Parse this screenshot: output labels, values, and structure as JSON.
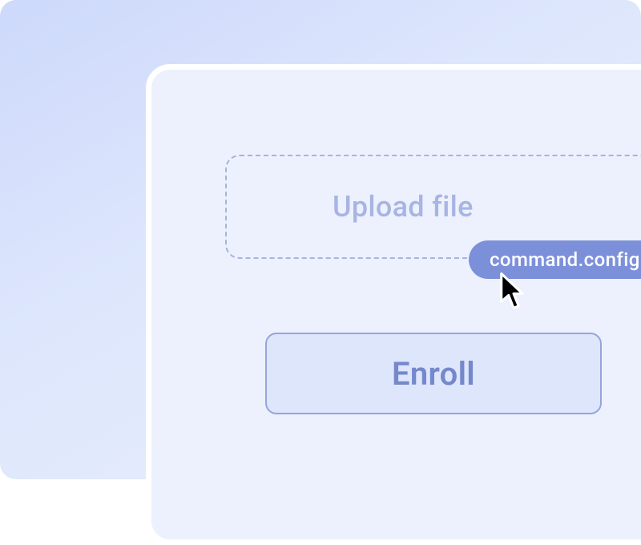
{
  "upload": {
    "label": "Upload file"
  },
  "file_chip": {
    "name": "command.config"
  },
  "buttons": {
    "enroll_label": "Enroll"
  },
  "colors": {
    "backdrop_start": "#cdd9fb",
    "backdrop_end": "#e9effd",
    "panel": "#edf1fd",
    "panel_border": "#ffffff",
    "dashed": "#a7b3e1",
    "placeholder": "#a8b4e2",
    "chip": "#7c90da",
    "button_bg": "#dee6fb",
    "button_border": "#95a4db",
    "button_text": "#7588cc"
  }
}
